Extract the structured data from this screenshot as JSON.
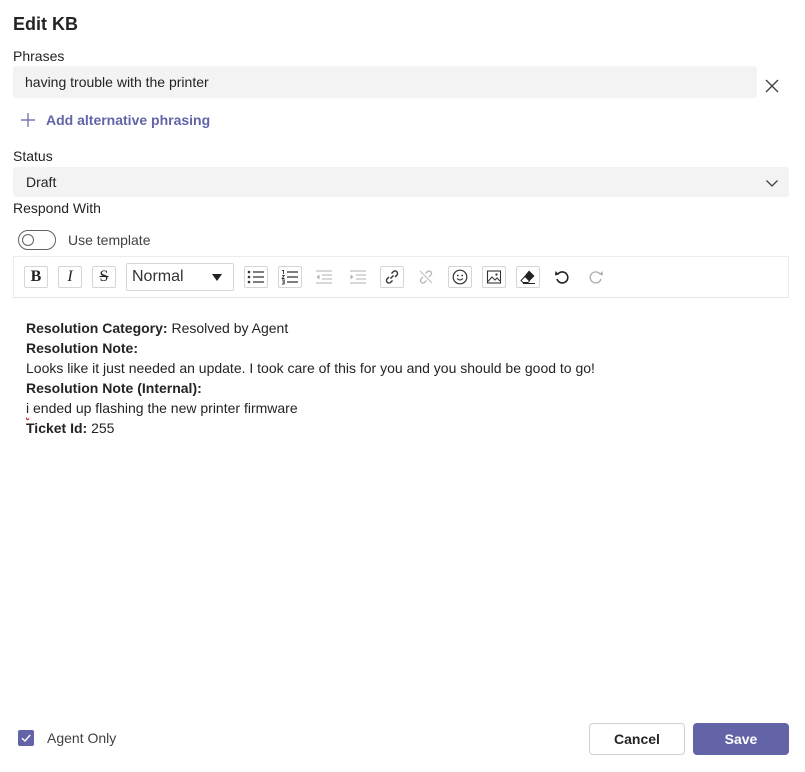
{
  "dialog": {
    "title": "Edit KB"
  },
  "phrases": {
    "label": "Phrases",
    "items": [
      {
        "value": "having trouble with the printer"
      }
    ],
    "add_alternative_label": "Add alternative phrasing"
  },
  "status": {
    "label": "Status",
    "selected": "Draft"
  },
  "respond_with": {
    "label": "Respond With",
    "use_template_label": "Use template",
    "use_template_on": false
  },
  "toolbar": {
    "format_selected": "Normal",
    "buttons": [
      "bold",
      "italic",
      "strikethrough",
      "bulleted-list",
      "numbered-list",
      "decrease-indent",
      "increase-indent",
      "link",
      "unlink",
      "emoji",
      "image",
      "clear-formatting",
      "undo",
      "redo"
    ]
  },
  "editor": {
    "resolution_category_label": "Resolution Category:",
    "resolution_category_value": " Resolved by Agent",
    "resolution_note_label": "Resolution Note:",
    "resolution_note_value": "Looks like it just needed an update. I took care of this for you and you should be good to go!",
    "resolution_note_internal_label": "Resolution Note (Internal):",
    "resolution_note_internal_first": "i",
    "resolution_note_internal_rest": " ended up flashing the new printer firmware",
    "ticket_id_label": "Ticket Id:",
    "ticket_id_value": " 255"
  },
  "footer": {
    "agent_only_label": "Agent Only",
    "agent_only_checked": true,
    "cancel_label": "Cancel",
    "save_label": "Save"
  },
  "colors": {
    "accent": "#6264a7",
    "field_background": "#f3f3f3",
    "text": "#242424"
  }
}
